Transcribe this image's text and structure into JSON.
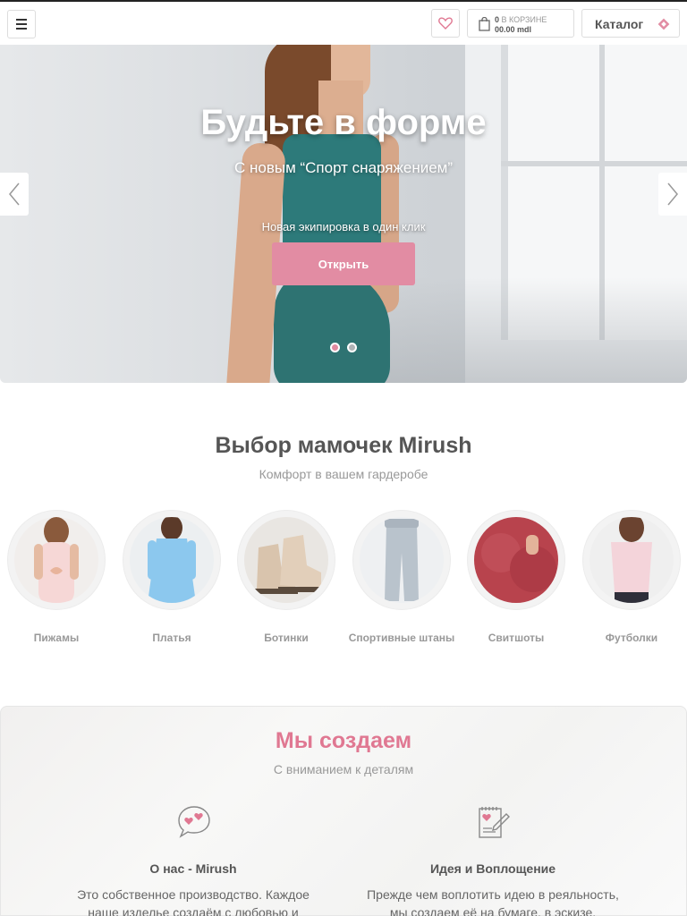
{
  "header": {
    "menu_icon": "hamburger-icon",
    "wishlist_icon": "heart-icon",
    "cart": {
      "icon": "shopping-bag-icon",
      "count": "0",
      "label": "В КОРЗИНЕ",
      "total": "00.00 mdl"
    },
    "catalog": {
      "label": "Каталог",
      "icon": "diamond-icon"
    }
  },
  "hero": {
    "title": "Будьте в форме",
    "subtitle": "С новым “Спорт снаряжением”",
    "note": "Новая экипировка в один клик",
    "button": "Открыть",
    "prev_icon": "chevron-left-icon",
    "next_icon": "chevron-right-icon",
    "slides_count": 2,
    "active_slide": 1
  },
  "choice": {
    "title": "Выбор мамочек Mirush",
    "subtitle": "Комфорт в вашем гардеробе",
    "categories": [
      {
        "label": "Пижамы"
      },
      {
        "label": "Платья"
      },
      {
        "label": "Ботинки"
      },
      {
        "label": "Спортивные штаны"
      },
      {
        "label": "Свитшоты"
      },
      {
        "label": "Футболки"
      }
    ]
  },
  "create": {
    "title": "Мы создаем",
    "subtitle": "С вниманием к деталям",
    "features": [
      {
        "icon": "chat-hearts-icon",
        "title": "О нас - Mirush",
        "text1": "Это собственное производство. Каждое",
        "text2": "наше изделье создаём с любовью и"
      },
      {
        "icon": "notepad-pencil-icon",
        "title": "Идея и Воплощение",
        "text1": "Прежде чем воплотить идею в реяльность,",
        "text2": "мы создаем её на бумаге, в эскизе."
      }
    ]
  },
  "colors": {
    "accent": "#e28ca3",
    "accent_text": "#e07892",
    "heading": "#555555",
    "muted": "#999999"
  }
}
